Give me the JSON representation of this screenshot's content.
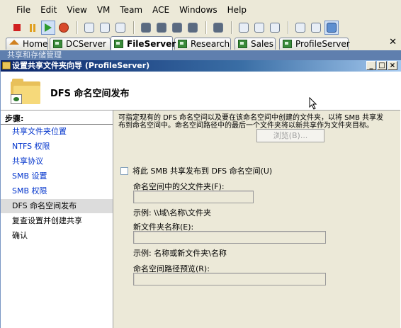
{
  "menu": [
    "File",
    "Edit",
    "View",
    "VM",
    "Team",
    "ACE",
    "Windows",
    "Help"
  ],
  "toolbar": {
    "icons": [
      "stop-icon",
      "pause-icon",
      "play-icon",
      "reset-icon",
      "snapshot-icon",
      "revert-icon",
      "snapshot-manager-icon",
      "team-icon",
      "team-add-icon",
      "network-icon",
      "connect-icon",
      "capture-icon",
      "sidebar-icon",
      "console-icon",
      "fullscreen-icon",
      "quick-switch-icon",
      "summary-icon",
      "console-view-icon"
    ]
  },
  "tabs": [
    {
      "label": "Home",
      "icon": "home-icon"
    },
    {
      "label": "DCServer",
      "icon": "vm-icon"
    },
    {
      "label": "FileServer",
      "icon": "vm-icon",
      "active": true
    },
    {
      "label": "Research",
      "icon": "vm-icon"
    },
    {
      "label": "Sales",
      "icon": "vm-icon"
    },
    {
      "label": "ProfileServer",
      "icon": "vm-icon"
    }
  ],
  "background_title": "共享和存储管理",
  "wizard": {
    "title": "设置共享文件夹向导 (ProfileServer)",
    "header_title": "DFS 命名空间发布",
    "steps_title": "步骤:",
    "steps": [
      {
        "label": "共享文件夹位置",
        "state": "link"
      },
      {
        "label": "NTFS 权限",
        "state": "link"
      },
      {
        "label": "共享协议",
        "state": "link"
      },
      {
        "label": "SMB 设置",
        "state": "link"
      },
      {
        "label": "SMB 权限",
        "state": "link"
      },
      {
        "label": "DFS 命名空间发布",
        "state": "current"
      },
      {
        "label": "复查设置并创建共享",
        "state": "plain"
      },
      {
        "label": "确认",
        "state": "plain"
      }
    ],
    "description": "可指定现有的 DFS 命名空间以及要在该命名空间中创建的文件夹，以将 SMB 共享发布到命名空间中。命名空间路径中的最后一个文件夹将以新共享作为文件夹目标。",
    "checkbox_label": "将此 SMB 共享发布到 DFS 命名空间(U)",
    "parent_folder_label": "命名空间中的父文件夹(F):",
    "parent_folder_value": "",
    "browse_label": "浏览(B)...",
    "parent_example": "示例: \\\\域\\名称\\文件夹",
    "new_folder_label": "新文件夹名称(E):",
    "new_folder_value": "",
    "new_folder_example": "示例: 名称或新文件夹\\名称",
    "preview_label": "命名空间路径预览(R):",
    "preview_value": ""
  }
}
